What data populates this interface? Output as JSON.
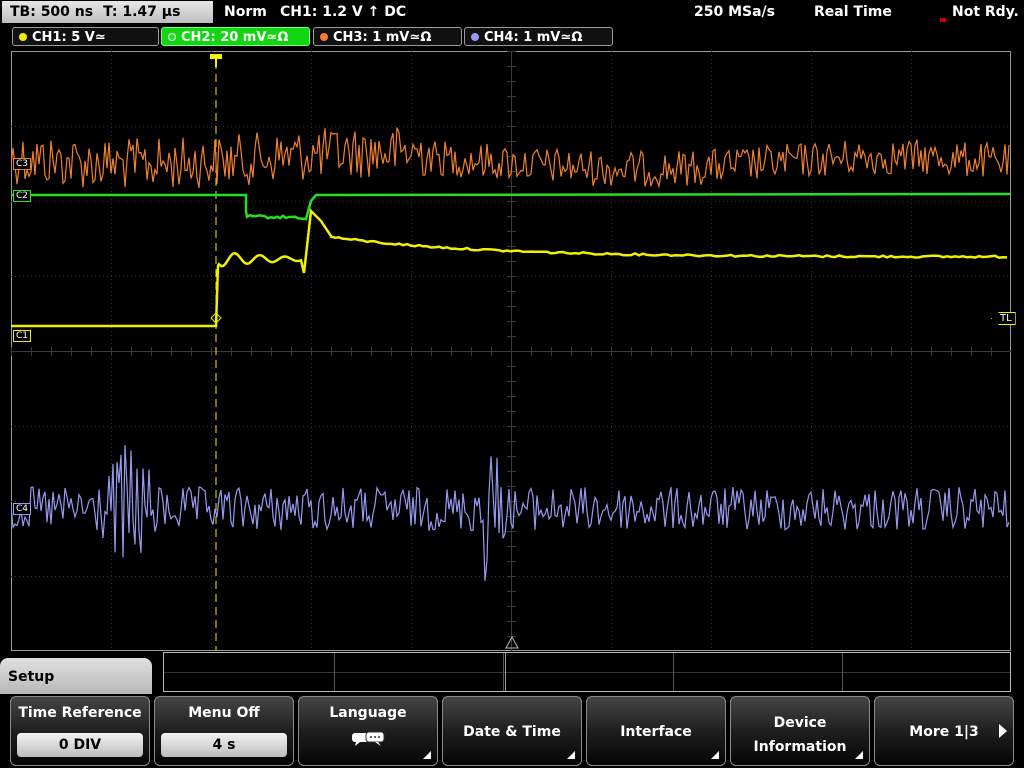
{
  "status": {
    "timebase": "TB: 500 ns",
    "trigger_time": "T: 1.47 µs",
    "trigger_mode": "Norm",
    "trigger_info": "CH1: 1.2 V ↑ DC",
    "sample_rate": "250 MSa/s",
    "acquisition": "Real Time",
    "state": "Not Rdy."
  },
  "channels": [
    {
      "label": "CH1: 5 V≃",
      "color": "#f0f000"
    },
    {
      "label": "CH2: 20 mV≃Ω",
      "color": "#23e023"
    },
    {
      "label": "CH3: 1 mV≃Ω",
      "color": "#f08030"
    },
    {
      "label": "CH4: 1 mV≃Ω",
      "color": "#9898f0"
    }
  ],
  "trace_labels": {
    "c1": "C1",
    "c2": "C2",
    "c3": "C3",
    "c4": "C4",
    "trigger_level": "TL"
  },
  "menu": {
    "title": "Setup",
    "softkeys": [
      {
        "label": "Time Reference",
        "value": "0 DIV"
      },
      {
        "label": "Menu Off",
        "value": "4 s"
      },
      {
        "label": "Language",
        "icon": "speech-bubble-icon"
      },
      {
        "label": "Date & Time"
      },
      {
        "label": "Interface"
      },
      {
        "label_line1": "Device",
        "label_line2": "Information"
      },
      {
        "label": "More 1|3"
      }
    ]
  },
  "colors": {
    "grid": "#3a3a3a",
    "trigger_marker": "#f0f000"
  }
}
